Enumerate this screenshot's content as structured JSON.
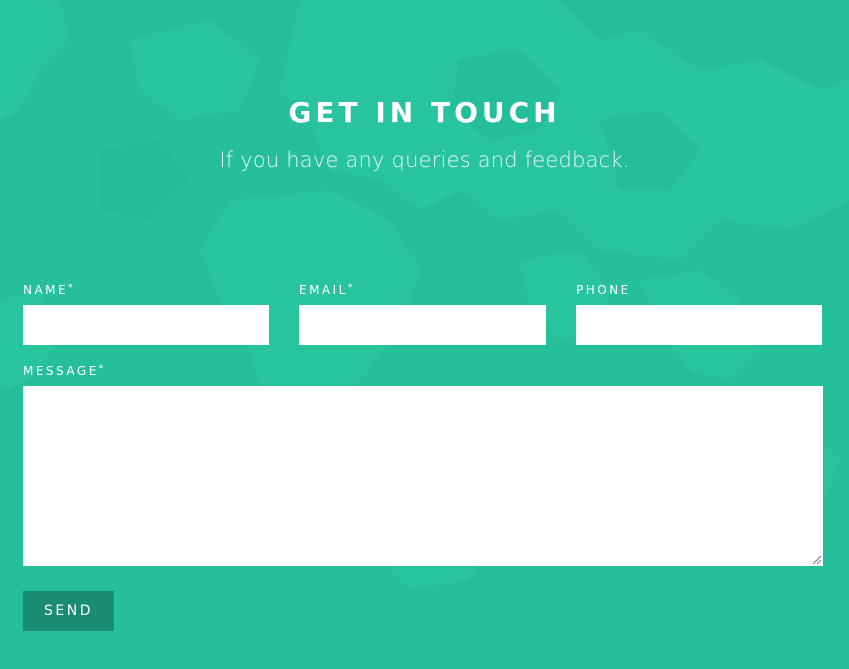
{
  "header": {
    "title": "GET IN TOUCH",
    "subtitle": "If you have any queries and feedback."
  },
  "form": {
    "name_label": "NAME",
    "email_label": "EMAIL",
    "phone_label": "PHONE",
    "message_label": "MESSAGE",
    "required_marker": "*",
    "name_value": "",
    "email_value": "",
    "phone_value": "",
    "message_value": "",
    "send_label": "SEND"
  },
  "colors": {
    "background": "#25bf9c",
    "button": "#1a8c72",
    "text": "#ffffff"
  }
}
